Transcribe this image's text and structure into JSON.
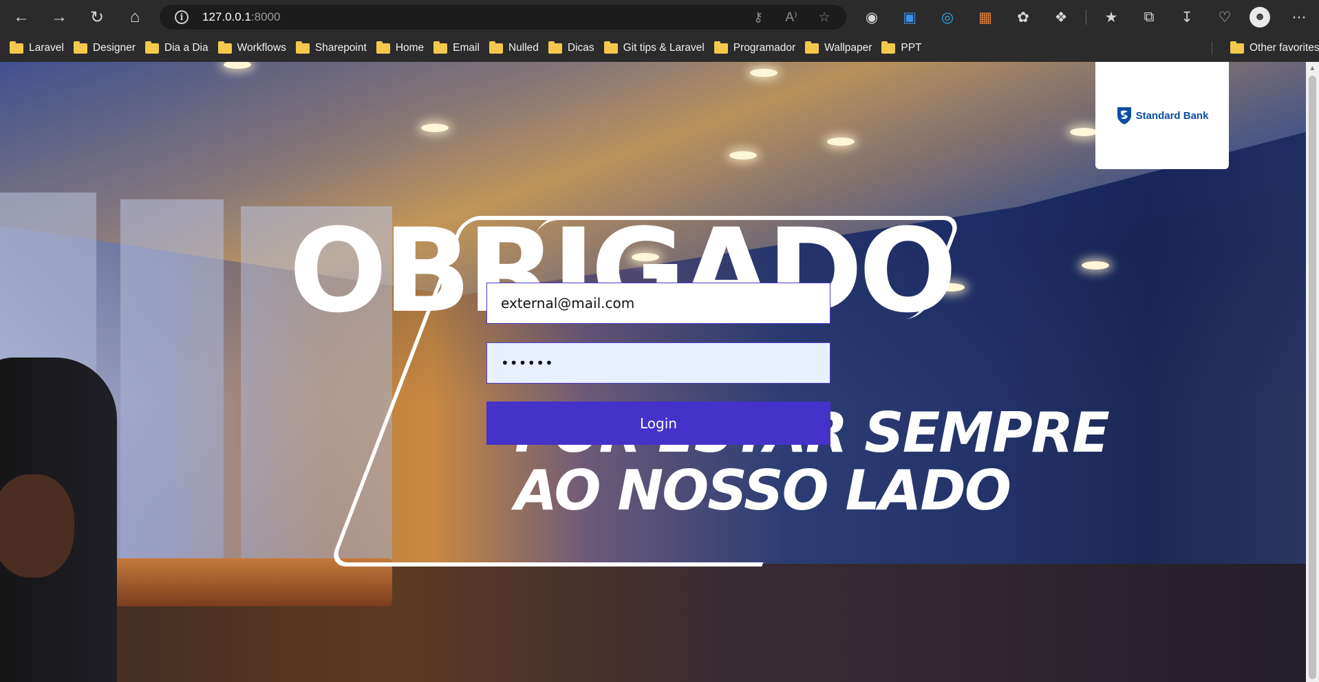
{
  "browser": {
    "url_host": "127.0.0.1",
    "url_port": ":8000",
    "bookmarks": [
      "Laravel",
      "Designer",
      "Dia a Dia",
      "Workflows",
      "Sharepoint",
      "Home",
      "Email",
      "Nulled",
      "Dicas",
      "Git tips & Laravel",
      "Programador",
      "Wallpaper",
      "PPT"
    ],
    "other_favorites": "Other favorites"
  },
  "hero": {
    "title": "OBRIGADO",
    "subtitle_line1": "POR ESTAR SEMPRE",
    "subtitle_line2": "AO NOSSO LADO"
  },
  "brand": {
    "name": "Standard Bank",
    "color": "#0a4ea5"
  },
  "login": {
    "email_value": "external@mail.com",
    "password_value": "••••••",
    "button_label": "Login",
    "button_color": "#4532c9"
  }
}
